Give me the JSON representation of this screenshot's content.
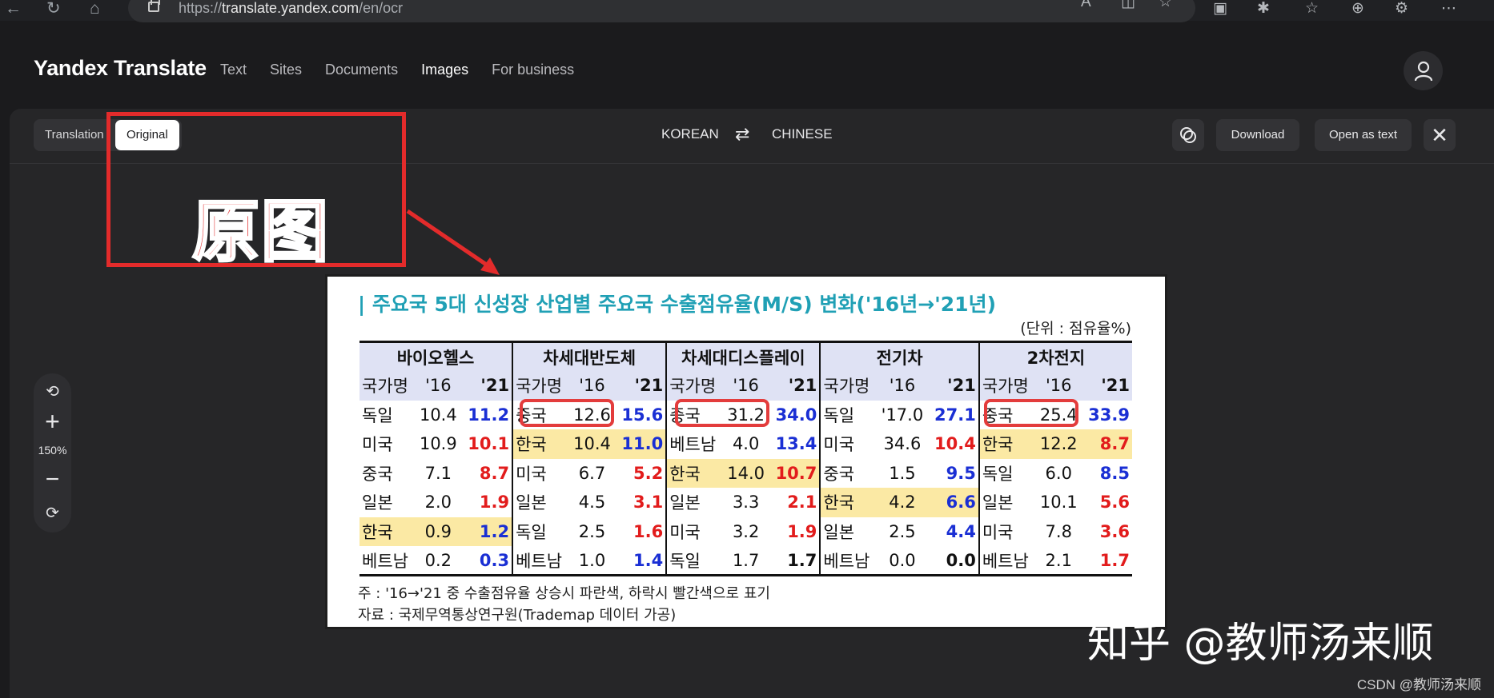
{
  "browser": {
    "url_prefix": "https://",
    "url_host": "translate.yandex.com",
    "url_path": "/en/ocr"
  },
  "header": {
    "brand": "Yandex Translate",
    "nav": [
      "Text",
      "Sites",
      "Documents",
      "Images",
      "For business"
    ],
    "active_nav": "Images"
  },
  "toolbar": {
    "view_tabs": [
      "Translation",
      "Original"
    ],
    "active_tab": "Original",
    "source_lang": "KOREAN",
    "target_lang": "CHINESE",
    "download_label": "Download",
    "open_as_text_label": "Open as text"
  },
  "zoom": {
    "level": "150%"
  },
  "annotation": {
    "label": "原图"
  },
  "image_content": {
    "title": "| 주요국 5대 신성장 산업별 주요국 수출점유율(M/S) 변화('16년→'21년)",
    "unit": "(단위 : 점유율%)",
    "groups": [
      "바이오헬스",
      "차세대반도체",
      "차세대디스플레이",
      "전기차",
      "2차전지"
    ],
    "subheader": [
      "국가명",
      "'16",
      "'21"
    ],
    "rows": [
      [
        [
          "독일",
          "10.4",
          "11.2",
          "blue",
          ""
        ],
        [
          "중국",
          "12.6",
          "15.6",
          "blue",
          ""
        ],
        [
          "중국",
          "31.2",
          "34.0",
          "blue",
          ""
        ],
        [
          "독일",
          "'17.0",
          "27.1",
          "blue",
          ""
        ],
        [
          "중국",
          "25.4",
          "33.9",
          "blue",
          ""
        ]
      ],
      [
        [
          "미국",
          "10.9",
          "10.1",
          "red",
          ""
        ],
        [
          "한국",
          "10.4",
          "11.0",
          "blue",
          "yel"
        ],
        [
          "베트남",
          "4.0",
          "13.4",
          "blue",
          ""
        ],
        [
          "미국",
          "34.6",
          "10.4",
          "red",
          ""
        ],
        [
          "한국",
          "12.2",
          "8.7",
          "red",
          "yel"
        ]
      ],
      [
        [
          "중국",
          "7.1",
          "8.7",
          "red",
          ""
        ],
        [
          "미국",
          "6.7",
          "5.2",
          "red",
          ""
        ],
        [
          "한국",
          "14.0",
          "10.7",
          "red",
          "yel"
        ],
        [
          "중국",
          "1.5",
          "9.5",
          "blue",
          ""
        ],
        [
          "독일",
          "6.0",
          "8.5",
          "blue",
          ""
        ]
      ],
      [
        [
          "일본",
          "2.0",
          "1.9",
          "red",
          ""
        ],
        [
          "일본",
          "4.5",
          "3.1",
          "red",
          ""
        ],
        [
          "일본",
          "3.3",
          "2.1",
          "red",
          ""
        ],
        [
          "한국",
          "4.2",
          "6.6",
          "blue",
          "yel"
        ],
        [
          "일본",
          "10.1",
          "5.6",
          "red",
          ""
        ]
      ],
      [
        [
          "한국",
          "0.9",
          "1.2",
          "blue",
          "yel"
        ],
        [
          "독일",
          "2.5",
          "1.6",
          "red",
          ""
        ],
        [
          "미국",
          "3.2",
          "1.9",
          "red",
          ""
        ],
        [
          "일본",
          "2.5",
          "4.4",
          "blue",
          ""
        ],
        [
          "미국",
          "7.8",
          "3.6",
          "red",
          ""
        ]
      ],
      [
        [
          "베트남",
          "0.2",
          "0.3",
          "blue",
          ""
        ],
        [
          "베트남",
          "1.0",
          "1.4",
          "blue",
          ""
        ],
        [
          "독일",
          "1.7",
          "1.7",
          "blk",
          ""
        ],
        [
          "베트남",
          "0.0",
          "0.0",
          "blk",
          ""
        ],
        [
          "베트남",
          "2.1",
          "1.7",
          "red",
          ""
        ]
      ]
    ],
    "note1": "주 : '16→'21 중 수출점유율 상승시 파란색, 하락시 빨간색으로 표기",
    "note2": "자료 : 국제무역통상연구원(Trademap 데이터 가공)"
  },
  "watermark": "知乎 @教师汤来顺",
  "credit": "CSDN @教师汤来顺",
  "colors": {
    "accent_red": "#e32b2b",
    "panel": "#262628",
    "bg": "#1b1b1d"
  }
}
